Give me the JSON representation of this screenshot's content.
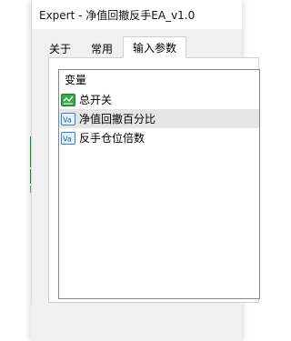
{
  "window": {
    "title": "Expert - 净值回撤反手EA_v1.0"
  },
  "tabs": [
    {
      "label": "关于",
      "active": false
    },
    {
      "label": "常用",
      "active": false
    },
    {
      "label": "输入参数",
      "active": true
    }
  ],
  "param_list": {
    "header": "变量",
    "items": [
      {
        "label": "总开关",
        "icon": "bool-param-icon",
        "selected": false
      },
      {
        "label": "净值回撤百分比",
        "icon": "value-param-icon",
        "selected": true
      },
      {
        "label": "反手仓位倍数",
        "icon": "value-param-icon",
        "selected": false
      }
    ]
  },
  "colors": {
    "selection": "#e5e5e5",
    "chart_green": "#1f9a3a",
    "dialog_bg": "#f0f0f0"
  }
}
